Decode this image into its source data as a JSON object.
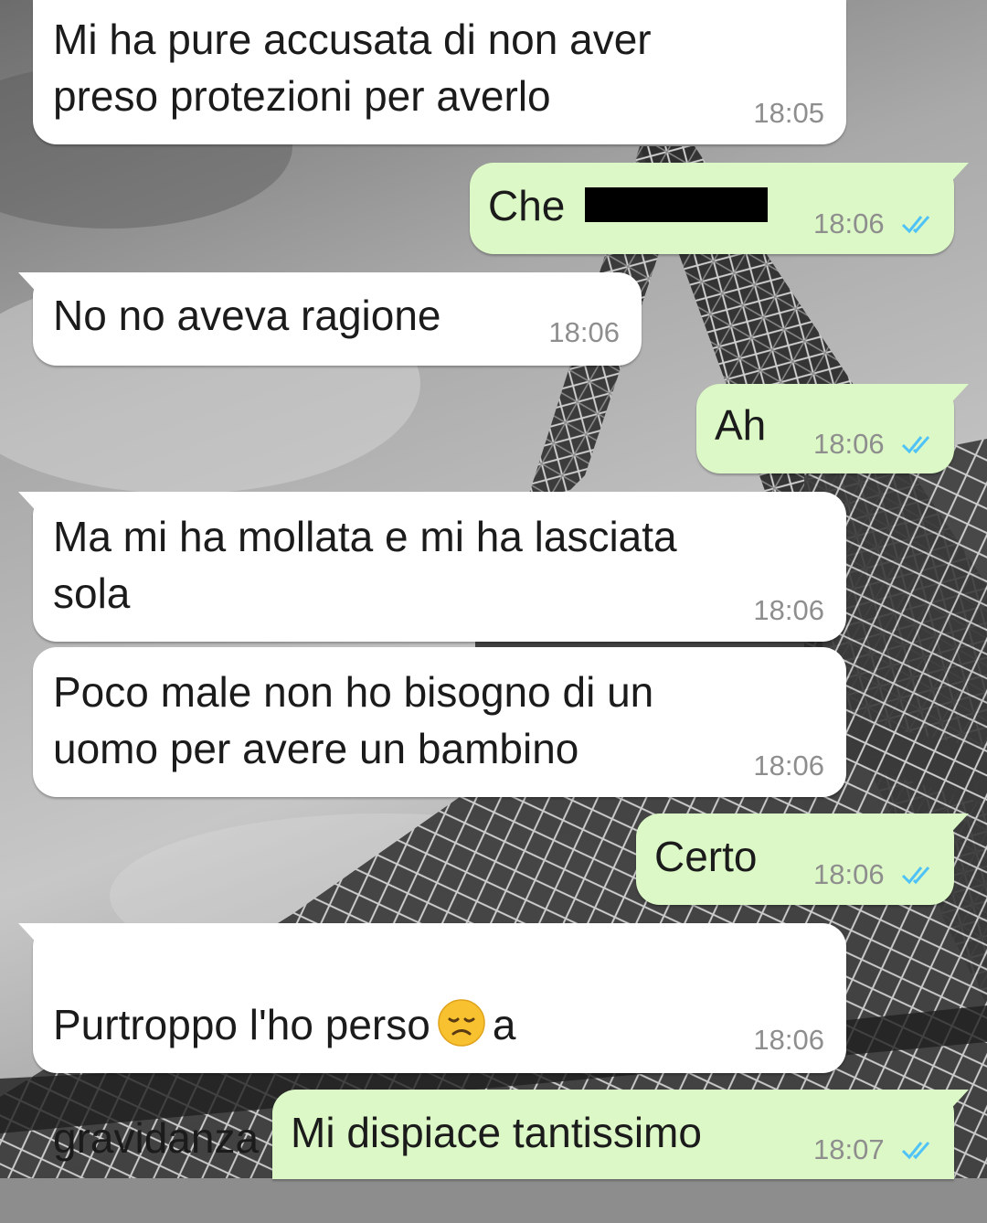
{
  "chat": {
    "messages": [
      {
        "side": "in",
        "text": "Mi ha pure accusata di non aver\npreso protezioni per averlo",
        "time": "18:05"
      },
      {
        "side": "out",
        "text": "Che",
        "time": "18:06",
        "status": "read",
        "redacted": true
      },
      {
        "side": "in",
        "text": "No no aveva ragione",
        "time": "18:06"
      },
      {
        "side": "out",
        "text": "Ah",
        "time": "18:06",
        "status": "read"
      },
      {
        "side": "in",
        "text": "Ma mi ha mollata e mi ha lasciata\nsola",
        "time": "18:06"
      },
      {
        "side": "in",
        "text": "Poco male non ho bisogno di un\nuomo per avere un bambino",
        "time": "18:06"
      },
      {
        "side": "out",
        "text": "Certo",
        "time": "18:06",
        "status": "read"
      },
      {
        "side": "in",
        "text_before": "Purtroppo l'ho perso",
        "emoji": "disappointed-face",
        "text_after": "a",
        "text_line2": "gravidanza avanzata",
        "time": "18:06"
      },
      {
        "side": "out",
        "text": "Mi dispiace tantissimo",
        "time": "18:07",
        "status": "read"
      }
    ]
  },
  "colors": {
    "incoming_bubble": "#ffffff",
    "outgoing_bubble": "#dcf8c6",
    "read_ticks": "#4fc3f7",
    "timestamp": "#8e8e8e"
  },
  "icons": {
    "read_receipt": "double-check-icon",
    "wallpaper": "eiffel-tower-wallpaper"
  }
}
